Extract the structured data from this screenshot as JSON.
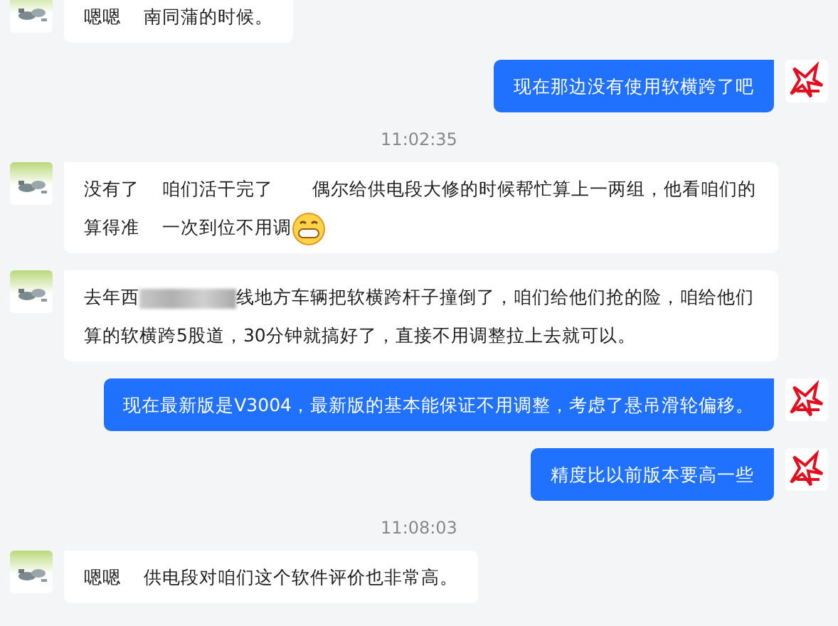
{
  "items": [
    {
      "kind": "incoming",
      "parts": [
        {
          "kind": "text",
          "text": "嗯嗯    南同蒲的时候。"
        }
      ]
    },
    {
      "kind": "outgoing",
      "parts": [
        {
          "kind": "text",
          "text": "现在那边没有使用软横跨了吧"
        }
      ]
    },
    {
      "kind": "time",
      "text": "11:02:35"
    },
    {
      "kind": "incoming",
      "parts": [
        {
          "kind": "text",
          "text": "没有了    咱们活干完了       偶尔给供电段大修的时候帮忙算上一两组，他看咱们的算得准    一次到位不用调"
        },
        {
          "kind": "emoji"
        }
      ]
    },
    {
      "kind": "incoming",
      "parts": [
        {
          "kind": "text",
          "text": "去年西"
        },
        {
          "kind": "redacted"
        },
        {
          "kind": "text",
          "text": "线地方车辆把软横跨杆子撞倒了，咱们给他们抢的险，咱给他们算的软横跨5股道，30分钟就搞好了，直接不用调整拉上去就可以。"
        }
      ]
    },
    {
      "kind": "outgoing",
      "parts": [
        {
          "kind": "text",
          "text": "现在最新版是V3004，最新版的基本能保证不用调整，考虑了悬吊滑轮偏移。"
        }
      ]
    },
    {
      "kind": "outgoing",
      "parts": [
        {
          "kind": "text",
          "text": "精度比以前版本要高一些"
        }
      ]
    },
    {
      "kind": "time",
      "text": "11:08:03"
    },
    {
      "kind": "incoming",
      "parts": [
        {
          "kind": "text",
          "text": "嗯嗯    供电段对咱们这个软件评价也非常高。"
        }
      ]
    }
  ]
}
